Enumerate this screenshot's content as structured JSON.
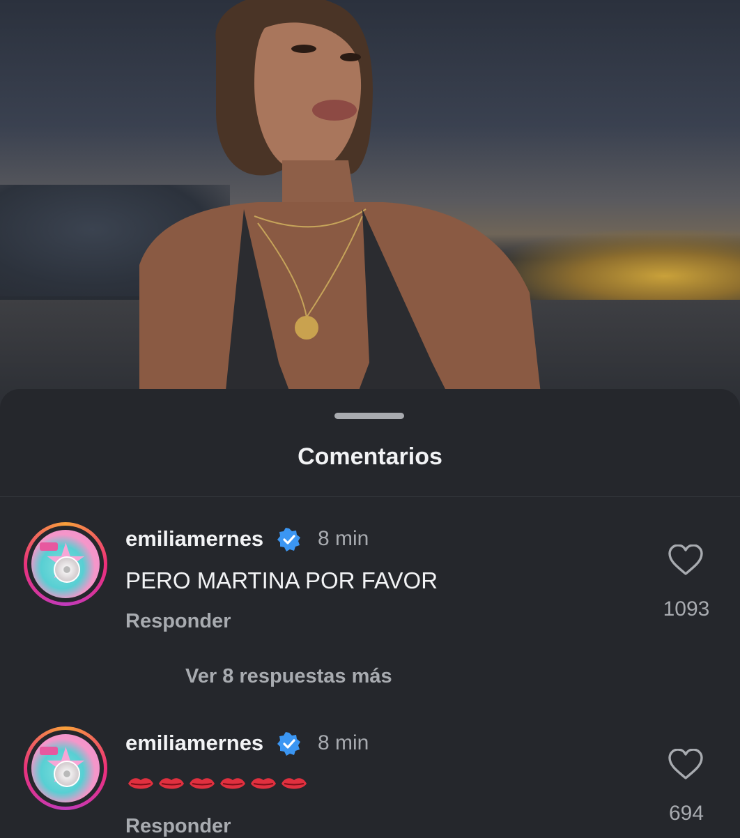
{
  "post_photo": {
    "alt": "photo"
  },
  "sheet": {
    "title": "Comentarios"
  },
  "comments": [
    {
      "username": "emiliamernes",
      "time": "8 min",
      "text": "PERO MARTINA POR FAVOR",
      "reply_label": "Responder",
      "likes": "1093",
      "view_replies": "Ver 8 respuestas más"
    },
    {
      "username": "emiliamernes",
      "time": "8 min",
      "text": "👄👄👄👄👄👄",
      "reply_label": "Responder",
      "likes": "694"
    }
  ],
  "colors": {
    "background": "#25272c",
    "text_primary": "#f2f3f5",
    "text_secondary": "#a8abb0",
    "verified": "#3b96f3",
    "lips": "#e0303f"
  },
  "icons": {
    "verified": "verified-badge-icon",
    "like": "heart-outline-icon",
    "lips": "lips-emoji-icon"
  }
}
